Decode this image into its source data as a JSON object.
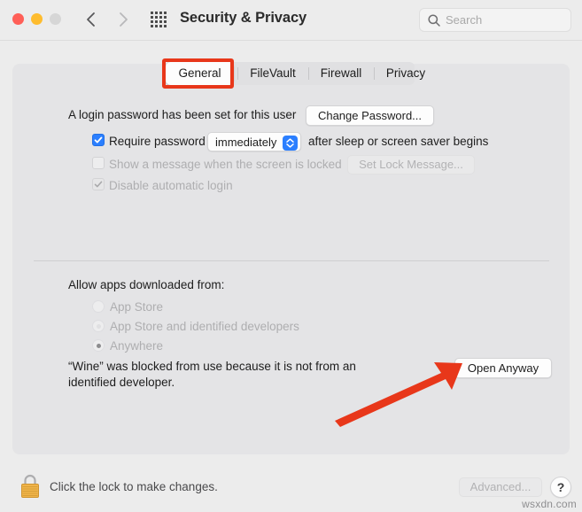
{
  "window": {
    "title": "Security & Privacy",
    "traffic_lights": {
      "close": "close-button",
      "minimize": "minimize-button",
      "zoom": "zoom-button"
    },
    "nav": {
      "back": "back-arrow",
      "forward": "forward-arrow"
    },
    "grid_button": "show-all-preferences",
    "search": {
      "placeholder": "Search",
      "value": ""
    }
  },
  "tabs": [
    {
      "label": "General",
      "selected": true
    },
    {
      "label": "FileVault",
      "selected": false
    },
    {
      "label": "Firewall",
      "selected": false
    },
    {
      "label": "Privacy",
      "selected": false
    }
  ],
  "login": {
    "status_text": "A login password has been set for this user",
    "change_password_label": "Change Password...",
    "require_password": {
      "checked": true,
      "label": "Require password",
      "interval": "immediately",
      "suffix": "after sleep or screen saver begins"
    },
    "show_message": {
      "checked": false,
      "enabled": false,
      "label": "Show a message when the screen is locked",
      "button_label": "Set Lock Message..."
    },
    "disable_auto_login": {
      "checked": true,
      "enabled": false,
      "label": "Disable automatic login"
    }
  },
  "allow_apps": {
    "heading": "Allow apps downloaded from:",
    "enabled": false,
    "options": [
      {
        "label": "App Store",
        "selected": false
      },
      {
        "label": "App Store and identified developers",
        "selected": false
      },
      {
        "label": "Anywhere",
        "selected": true
      }
    ]
  },
  "blocked": {
    "message": "“Wine” was blocked from use because it is not from an identified developer.",
    "open_anyway_label": "Open Anyway"
  },
  "bottom": {
    "lock_icon": "locked-padlock",
    "lock_text": "Click the lock to make changes.",
    "advanced_label": "Advanced...",
    "advanced_enabled": false,
    "help_label": "?"
  },
  "watermark": "wsxdn.com",
  "annotations": {
    "highlight_target": "General",
    "arrow_target": "Open Anyway",
    "color": "#e8371a"
  },
  "colors": {
    "accent_blue": "#2b7fff",
    "annotation_red": "#e8371a",
    "window_bg": "#ececec",
    "panel_bg": "#e4e4e6",
    "lock_gold": "#f0b44a"
  }
}
